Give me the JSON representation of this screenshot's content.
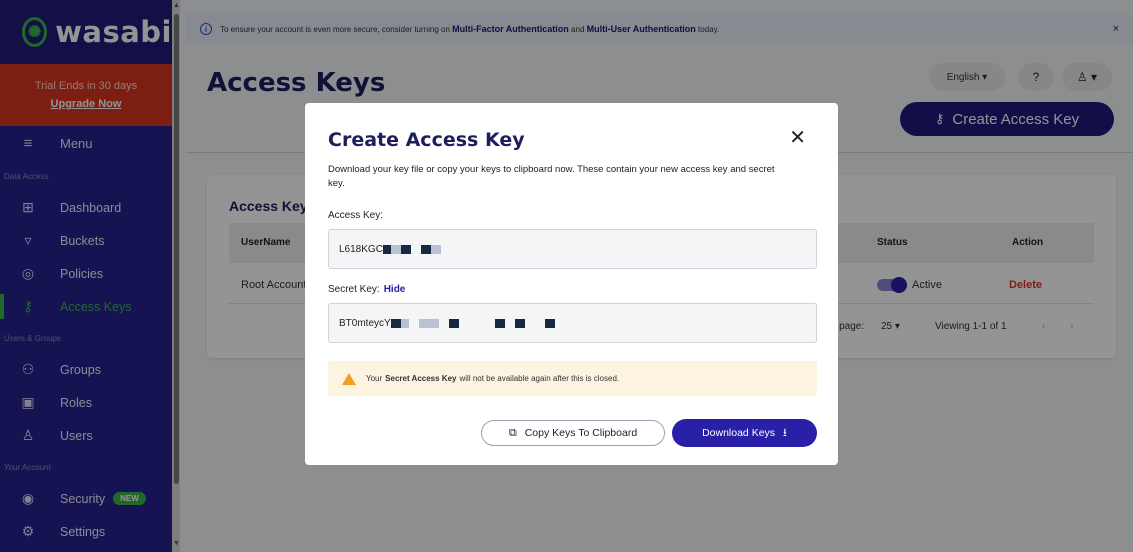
{
  "brand": {
    "name": "wasabi"
  },
  "trial": {
    "text": "Trial Ends in 30 days",
    "upgrade": "Upgrade Now"
  },
  "sidebar": {
    "menu_label": "Menu",
    "sections": [
      "Data Access",
      "Users & Groups",
      "Your Account"
    ],
    "items": [
      {
        "label": "Dashboard",
        "icon": "dashboard-icon"
      },
      {
        "label": "Buckets",
        "icon": "bucket-icon"
      },
      {
        "label": "Policies",
        "icon": "policy-icon"
      },
      {
        "label": "Access Keys",
        "icon": "key-icon",
        "active": true
      },
      {
        "label": "Groups",
        "icon": "groups-icon"
      },
      {
        "label": "Roles",
        "icon": "roles-icon"
      },
      {
        "label": "Users",
        "icon": "user-icon"
      },
      {
        "label": "Security",
        "icon": "security-icon",
        "badge": "NEW"
      },
      {
        "label": "Settings",
        "icon": "settings-icon"
      }
    ]
  },
  "banner": {
    "pre": "To ensure your account is even more secure, consider turning on",
    "mfa": "Multi-Factor Authentication",
    "and": "and",
    "mua": "Multi-User Authentication",
    "post": "today.",
    "close": "×"
  },
  "header": {
    "title": "Access Keys",
    "language": "English",
    "create_button": "Create Access Key"
  },
  "table": {
    "title": "Access Keys",
    "columns": {
      "username": "UserName",
      "status": "Status",
      "action": "Action"
    },
    "rows": [
      {
        "username": "Root Account",
        "status": "Active",
        "action": "Delete"
      }
    ],
    "pagination": {
      "per_page_label": "r page:",
      "per_page_value": "25",
      "viewing": "Viewing 1-1 of 1"
    }
  },
  "modal": {
    "title": "Create Access Key",
    "description": "Download your key file or copy your keys to clipboard now. These contain your new access key and secret key.",
    "access_key_label": "Access Key:",
    "access_key_value": "L618KGC",
    "secret_key_label": "Secret Key:",
    "hide_link": "Hide",
    "secret_key_value": "BT0mteycY",
    "warning_pre": "Your",
    "warning_bold": "Secret Access Key",
    "warning_post": "will not be available again after this is closed.",
    "copy_button": "Copy Keys To Clipboard",
    "download_button": "Download Keys"
  },
  "colors": {
    "sidebar": "#25228e",
    "brand_green": "#3cb44a",
    "accent": "#2a20a8",
    "danger": "#d6361f"
  }
}
